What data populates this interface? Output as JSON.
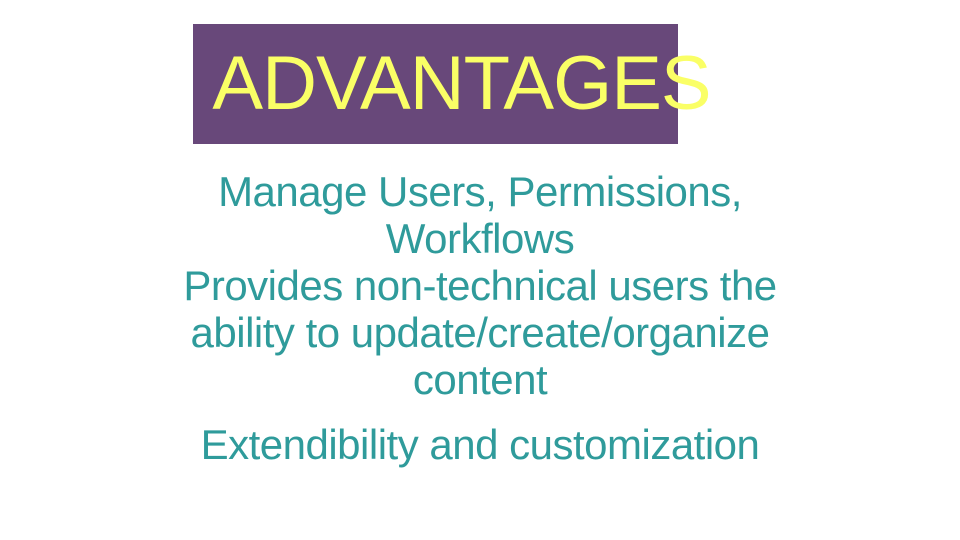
{
  "title": "ADVANTAGES",
  "points": {
    "p1": "Manage Users, Permissions, Workflows",
    "p2": "Provides non-technical users the ability to update/create/organize content",
    "p3": "Extendibility and customization"
  }
}
